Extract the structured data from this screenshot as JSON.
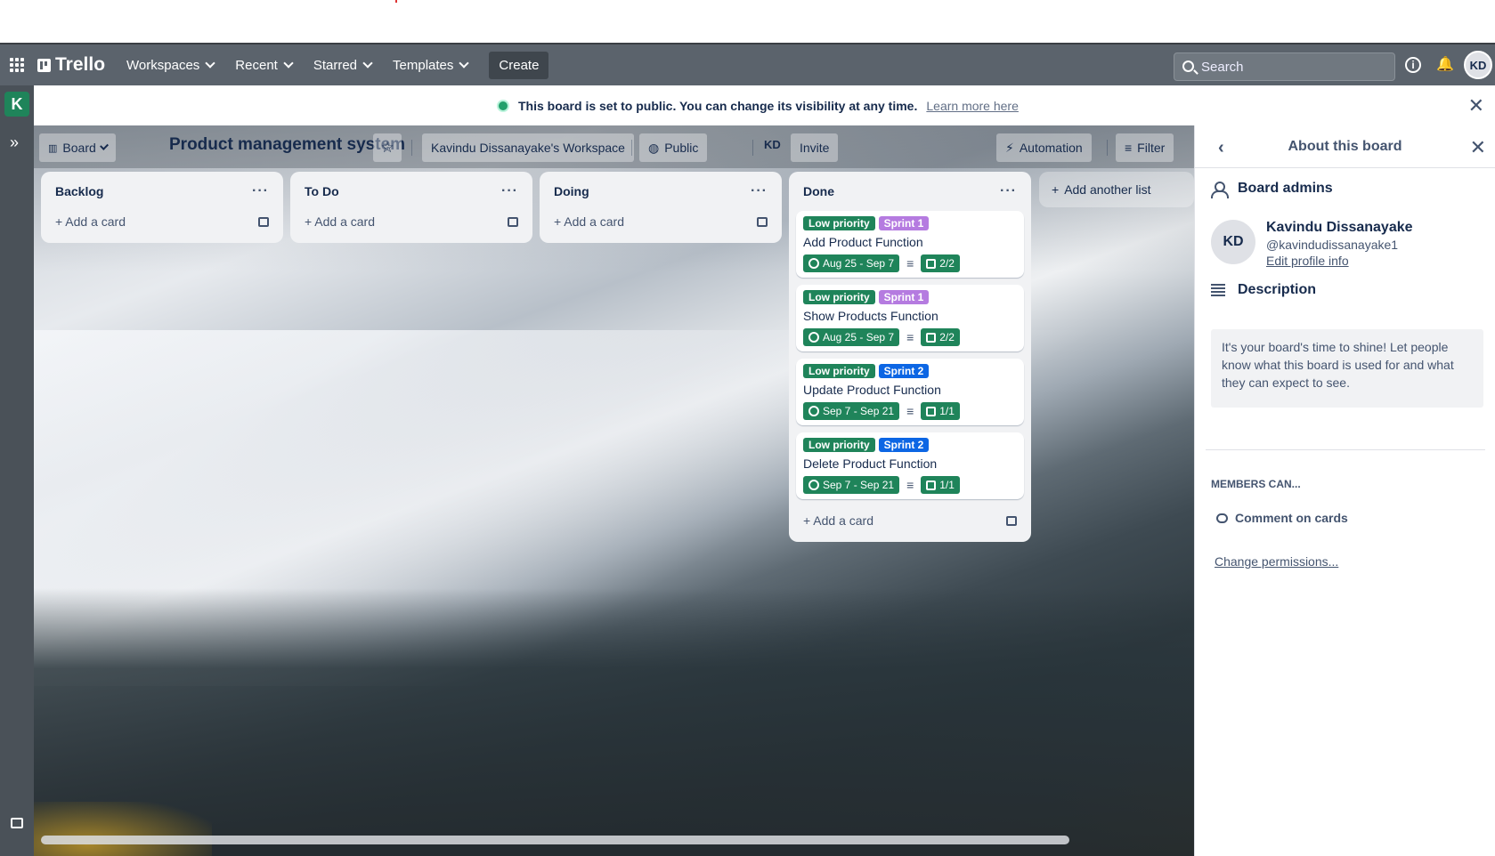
{
  "app": {
    "name": "Trello"
  },
  "topnav": {
    "items": [
      "Workspaces",
      "Recent",
      "Starred",
      "Templates"
    ],
    "create_label": "Create",
    "search_placeholder": "Search",
    "avatar_initials": "KD"
  },
  "sidebar": {
    "workspace_initial": "K"
  },
  "notice": {
    "text": "This board is set to public. You can change its visibility at any time.",
    "link": "Learn more here"
  },
  "board": {
    "view_label": "Board",
    "title": "Product management system",
    "workspace": "Kavindu Dissanayake's Workspace",
    "visibility": "Public",
    "member_initials": "KD",
    "invite_label": "Invite",
    "automation_label": "Automation",
    "filter_label": "Filter",
    "add_list_label": "Add another list"
  },
  "lists": [
    {
      "name": "Backlog",
      "add_card": "Add a card"
    },
    {
      "name": "To Do",
      "add_card": "Add a card"
    },
    {
      "name": "Doing",
      "add_card": "Add a card"
    },
    {
      "name": "Done",
      "add_card": "Add a card",
      "cards": [
        {
          "labels": [
            "Low priority",
            "Sprint 1"
          ],
          "title": "Add Product Function",
          "dates": "Aug 25 - Sep 7",
          "checklist": "2/2"
        },
        {
          "labels": [
            "Low priority",
            "Sprint 1"
          ],
          "title": "Show Products Function",
          "dates": "Aug 25 - Sep 7",
          "checklist": "2/2"
        },
        {
          "labels": [
            "Low priority",
            "Sprint 2"
          ],
          "title": "Update Product Function",
          "dates": "Sep 7 - Sep 21",
          "checklist": "1/1"
        },
        {
          "labels": [
            "Low priority",
            "Sprint 2"
          ],
          "title": "Delete Product Function",
          "dates": "Sep 7 - Sep 21",
          "checklist": "1/1"
        }
      ]
    }
  ],
  "colors": {
    "low_priority": "#1f845a",
    "sprint_1": "#9f8fef",
    "sprint_2": "#0c66e4",
    "workspace_badge": "#1f845a"
  },
  "panel": {
    "title": "About this board",
    "admins_heading": "Board admins",
    "admin": {
      "initials": "KD",
      "name": "Kavindu Dissanayake",
      "handle": "@kavindudissanayake1",
      "edit": "Edit profile info"
    },
    "description_heading": "Description",
    "description_placeholder": "It's your board's time to shine! Let people know what this board is used for and what they can expect to see.",
    "members_title": "MEMBERS CAN...",
    "permission": "Comment on cards",
    "change_permissions": "Change permissions..."
  }
}
